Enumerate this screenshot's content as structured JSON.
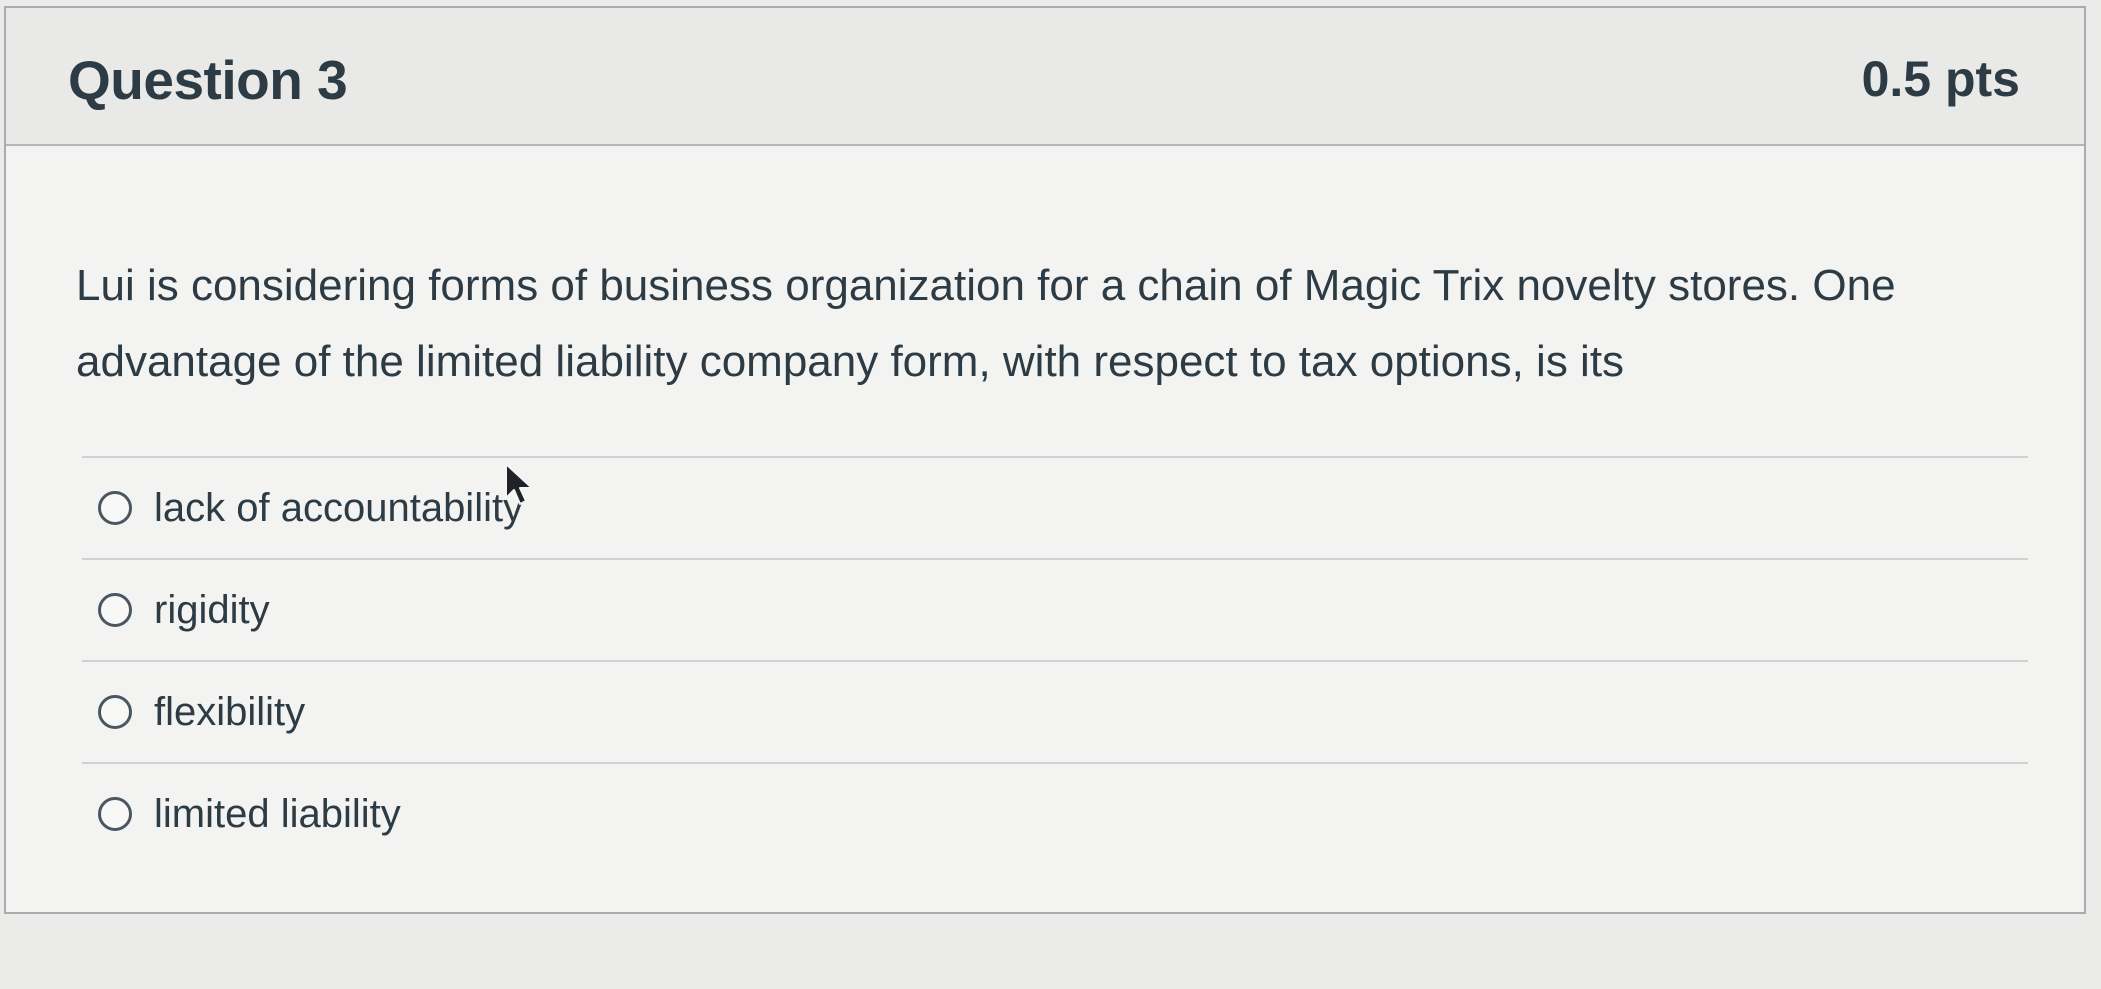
{
  "question": {
    "title": "Question 3",
    "points": "0.5 pts",
    "text": "Lui is considering forms of business organization for a chain of Magic Trix novelty stores. One advantage of the limited liability company form, with respect to tax options, is its"
  },
  "answers": [
    {
      "label": "lack of accountability"
    },
    {
      "label": "rigidity"
    },
    {
      "label": "flexibility"
    },
    {
      "label": "limited liability"
    }
  ],
  "icons": {
    "radio": "radio-unselected-icon",
    "cursor": "mouse-pointer-icon"
  },
  "colors": {
    "text": "#2d3b45",
    "header_bg": "#e9e9e7",
    "border": "#a9abad"
  }
}
